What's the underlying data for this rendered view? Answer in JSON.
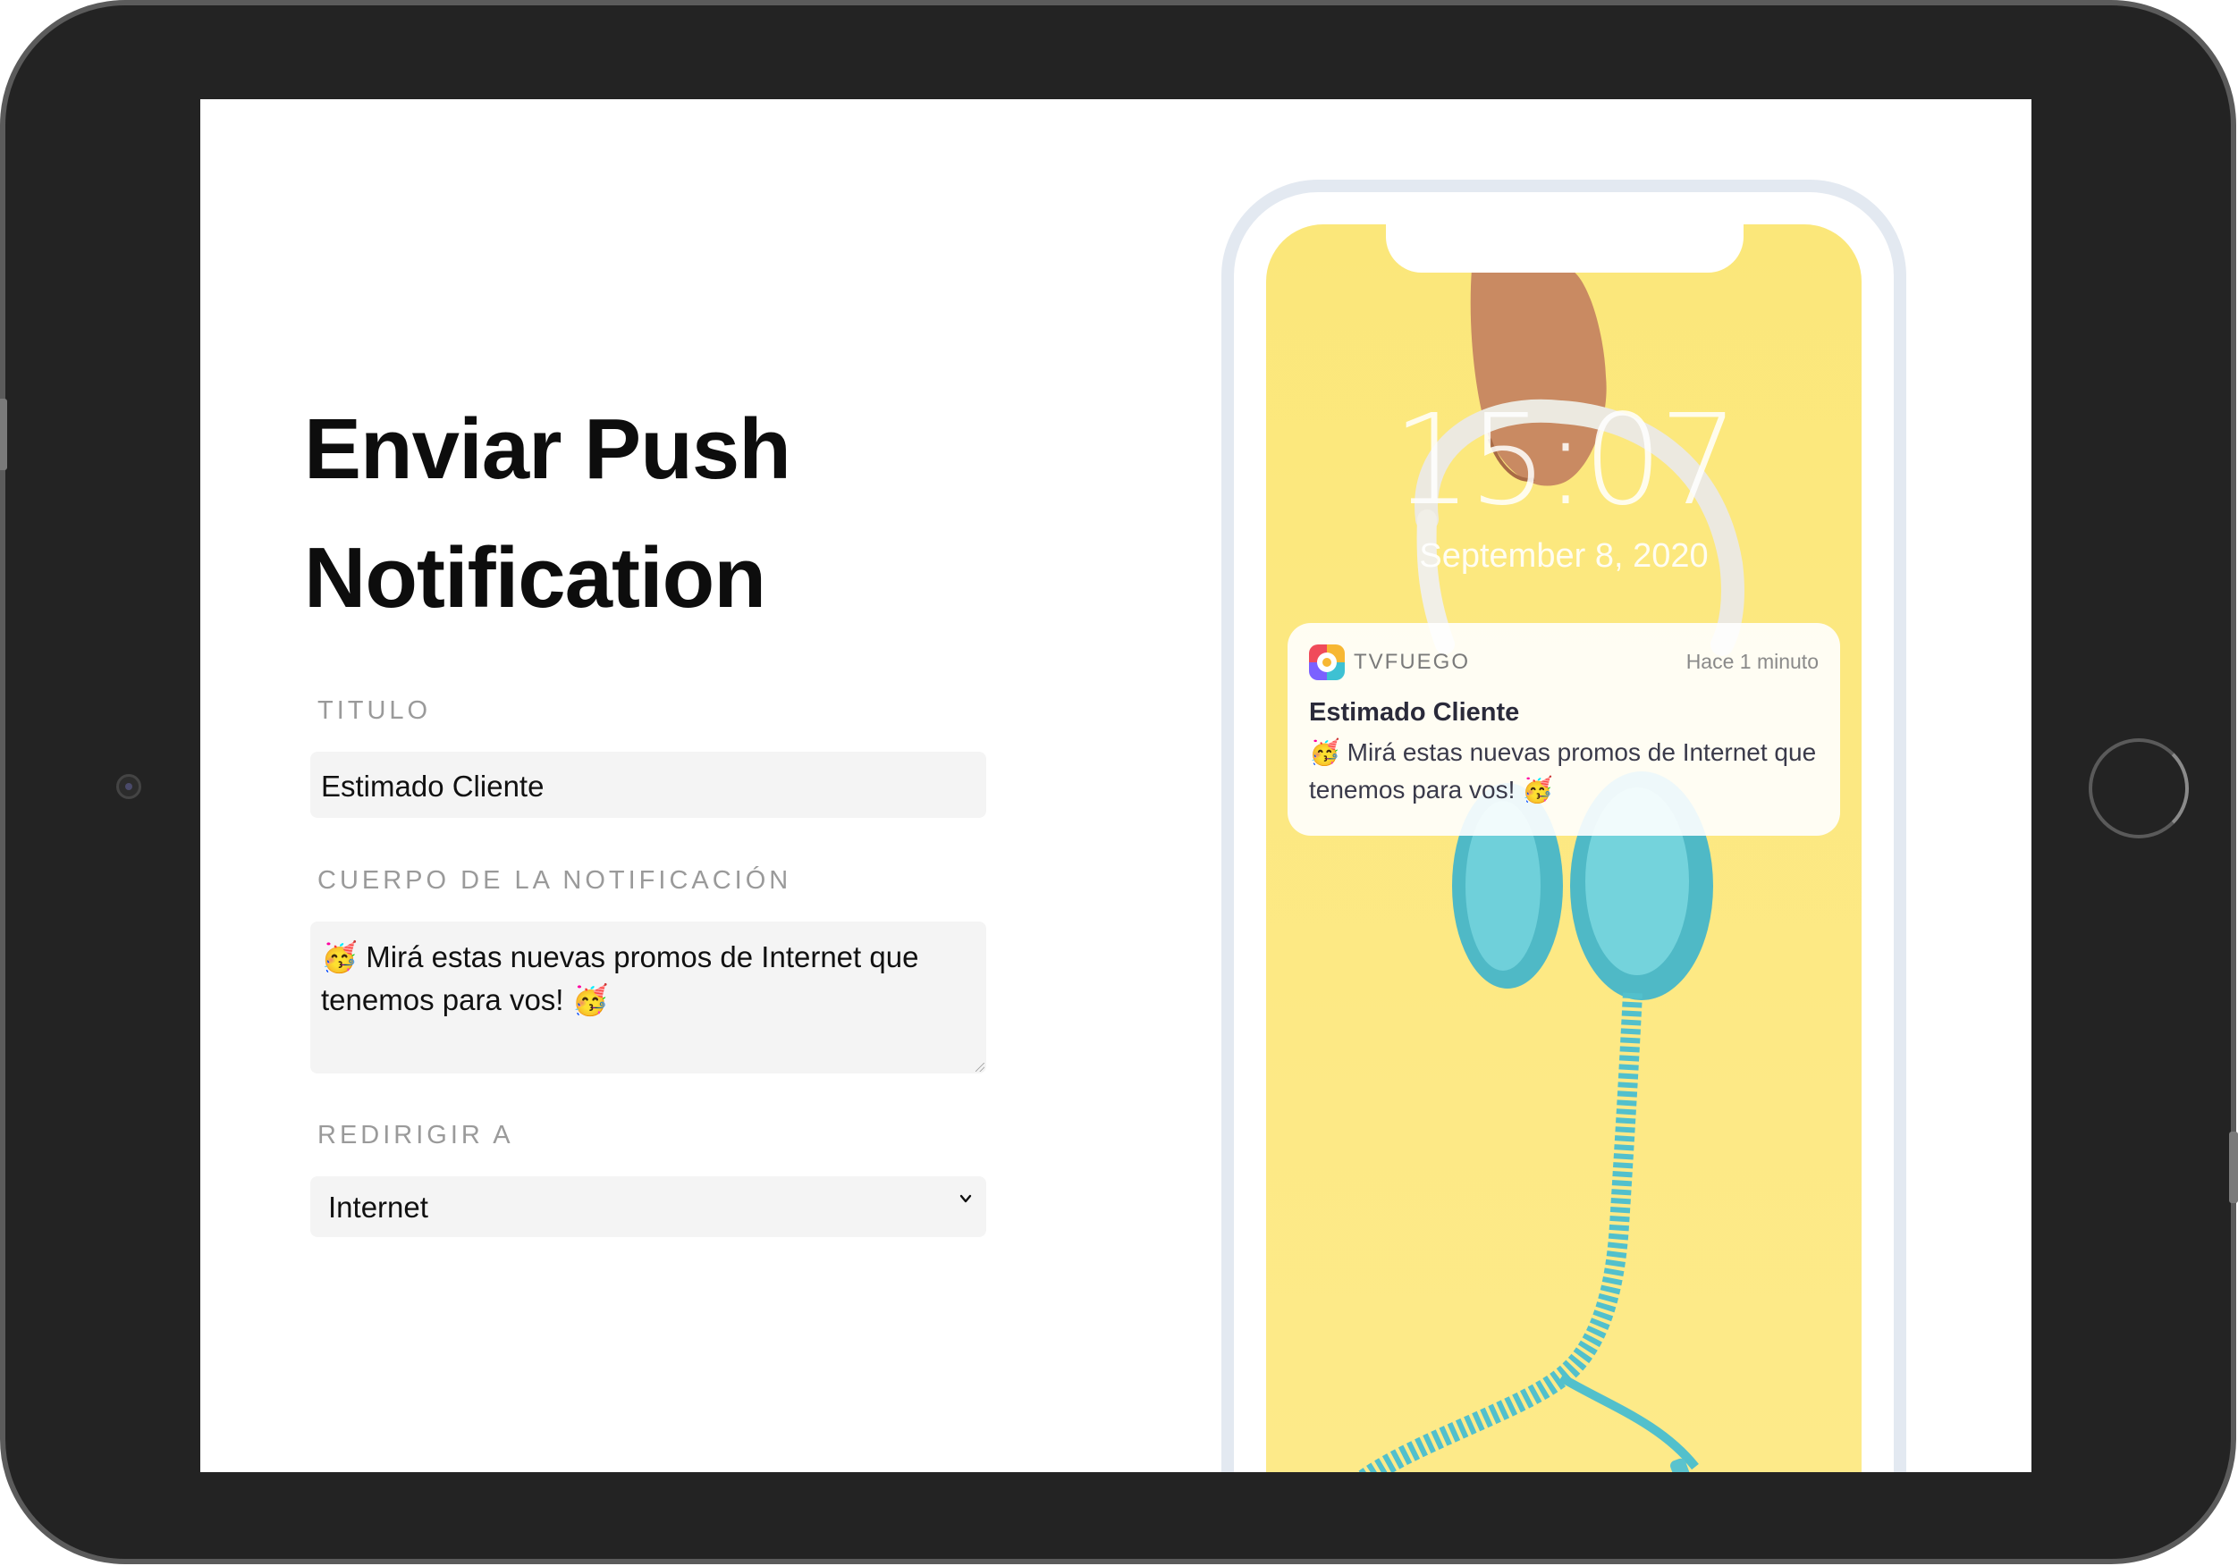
{
  "form": {
    "heading": "Enviar Push Notification",
    "title_label": "TITULO",
    "title_value": "Estimado Cliente",
    "body_label": "CUERPO DE LA NOTIFICACIÓN",
    "body_value": "🥳  Mirá estas nuevas promos de Internet que tenemos para vos! 🥳",
    "redirect_label": "REDIRIGIR A",
    "redirect_value": "Internet"
  },
  "lockscreen": {
    "time": "15:07",
    "date": "September 8, 2020"
  },
  "notification": {
    "app_name": "TVFUEGO",
    "time_ago": "Hace 1 minuto",
    "title": "Estimado Cliente",
    "body": "🥳 Mirá estas nuevas promos de Internet que tenemos para vos! 🥳"
  },
  "icons": {
    "app_icon": "tvfuego-app-icon",
    "select_chevron": "chevron-down-icon"
  },
  "colors": {
    "frame": "#232323",
    "wallpaper": "#fbe77a",
    "input_bg": "#f4f4f4",
    "headphones": "#5cc6d0"
  }
}
